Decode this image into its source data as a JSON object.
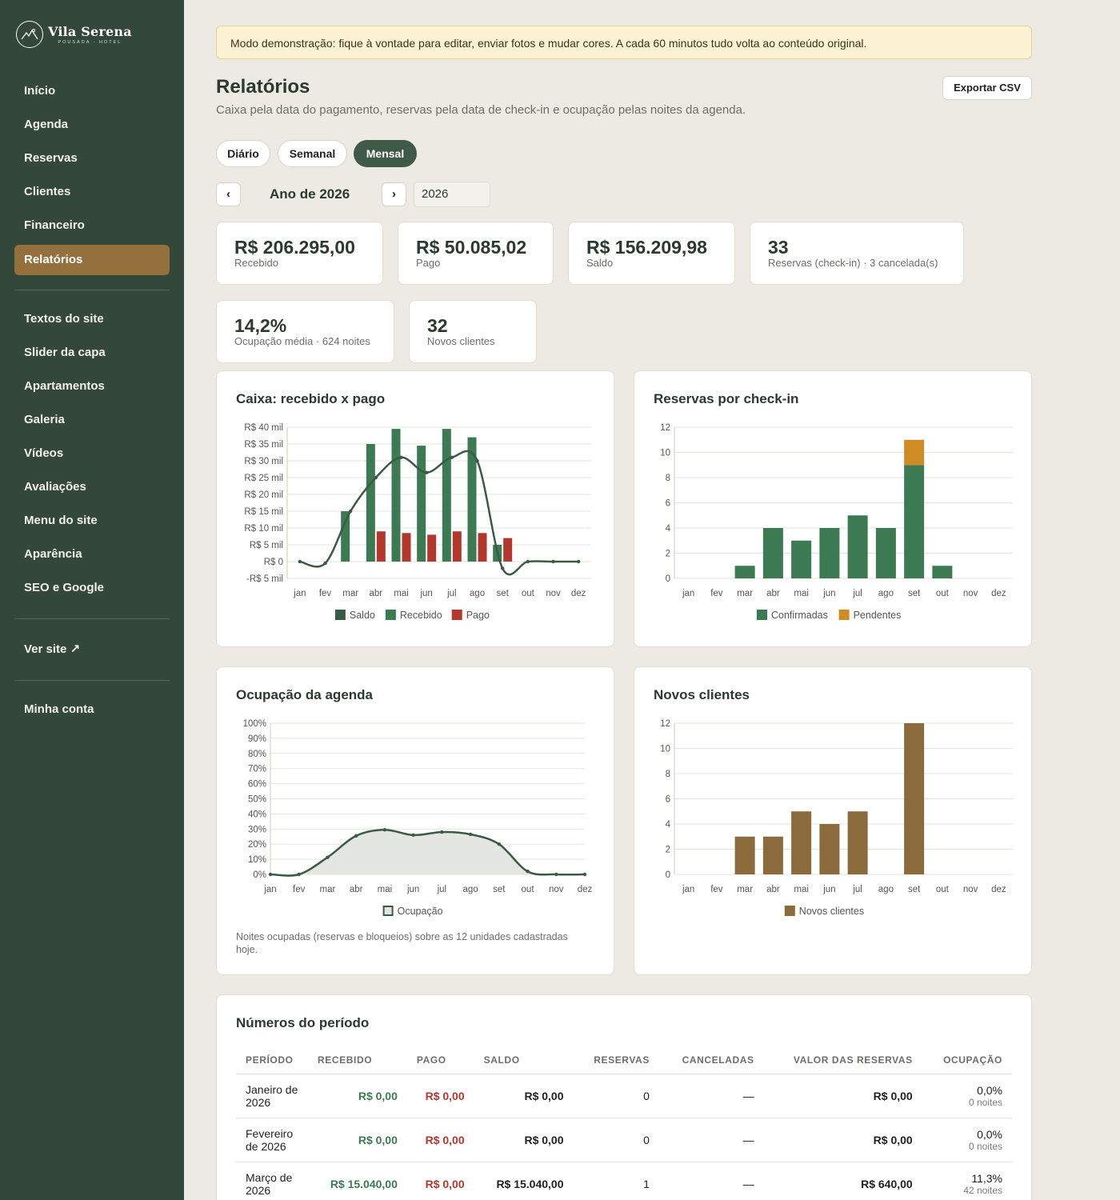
{
  "sidebar": {
    "brand_name": "Vila Serena",
    "brand_sub": "POUSADA · HOTEL",
    "items": [
      {
        "label": "Início"
      },
      {
        "label": "Agenda"
      },
      {
        "label": "Reservas"
      },
      {
        "label": "Clientes"
      },
      {
        "label": "Financeiro"
      },
      {
        "label": "Relatórios",
        "active": true
      },
      {
        "label": "Textos do site"
      },
      {
        "label": "Slider da capa"
      },
      {
        "label": "Apartamentos"
      },
      {
        "label": "Galeria"
      },
      {
        "label": "Vídeos"
      },
      {
        "label": "Avaliações"
      },
      {
        "label": "Menu do site"
      },
      {
        "label": "Aparência"
      },
      {
        "label": "SEO e Google"
      },
      {
        "label": "Ver site ↗"
      },
      {
        "label": "Minha conta"
      }
    ]
  },
  "banner": "Modo demonstração: fique à vontade para editar, enviar fotos e mudar cores. A cada 60 minutos tudo volta ao conteúdo original.",
  "header": {
    "title": "Relatórios",
    "subtitle": "Caixa pela data do pagamento, reservas pela data de check-in e ocupação pelas noites da agenda.",
    "export_label": "Exportar CSV"
  },
  "tabs": {
    "daily": "Diário",
    "weekly": "Semanal",
    "monthly": "Mensal",
    "active": "Mensal"
  },
  "period": {
    "prev": "‹",
    "next": "›",
    "label": "Ano de 2026",
    "year_value": "2026"
  },
  "kpis": [
    {
      "value": "R$ 206.295,00",
      "label": "Recebido"
    },
    {
      "value": "R$ 50.085,02",
      "label": "Pago"
    },
    {
      "value": "R$ 156.209,98",
      "label": "Saldo"
    },
    {
      "value": "33",
      "label": "Reservas (check-in) · 3 cancelada(s)"
    },
    {
      "value": "14,2%",
      "label": "Ocupação média · 624 noites"
    },
    {
      "value": "32",
      "label": "Novos clientes"
    }
  ],
  "colors": {
    "saldo": "#3a5a44",
    "recebido": "#3b7a52",
    "pago": "#b2382e",
    "pendentes": "#d08c24",
    "brown": "#8b6a3c",
    "occupancy_fill": "#e4e6e1"
  },
  "chart_data": [
    {
      "type": "bar",
      "title": "Caixa: recebido x pago",
      "categories": [
        "jan",
        "fev",
        "mar",
        "abr",
        "mai",
        "jun",
        "jul",
        "ago",
        "set",
        "out",
        "nov",
        "dez"
      ],
      "ytick_labels": [
        "R$ 40 mil",
        "R$ 35 mil",
        "R$ 30 mil",
        "R$ 25 mil",
        "R$ 20 mil",
        "R$ 15 mil",
        "R$ 10 mil",
        "R$ 5 mil",
        "R$ 0",
        "-R$ 5 mil"
      ],
      "ylim": [
        -5,
        40
      ],
      "yunit": "R$ mil",
      "series": [
        {
          "name": "Saldo",
          "kind": "line",
          "color": "#3a5a44",
          "values": [
            0,
            -0.5,
            15,
            25,
            31,
            26.5,
            31,
            30,
            -2,
            0,
            0,
            0
          ]
        },
        {
          "name": "Recebido",
          "kind": "bar",
          "color": "#3b7a52",
          "values": [
            0,
            0,
            15,
            35,
            39.5,
            34.5,
            39.5,
            37,
            5,
            0,
            0,
            0
          ]
        },
        {
          "name": "Pago",
          "kind": "bar",
          "color": "#b2382e",
          "values": [
            0,
            0,
            0,
            9,
            8.5,
            8,
            9,
            8.5,
            7,
            0,
            0,
            0
          ]
        }
      ],
      "legend": "bottom"
    },
    {
      "type": "bar",
      "stacked": true,
      "title": "Reservas por check-in",
      "categories": [
        "jan",
        "fev",
        "mar",
        "abr",
        "mai",
        "jun",
        "jul",
        "ago",
        "set",
        "out",
        "nov",
        "dez"
      ],
      "ytick_labels": [
        "12",
        "10",
        "8",
        "6",
        "4",
        "2",
        "0"
      ],
      "ylim": [
        0,
        12
      ],
      "series": [
        {
          "name": "Confirmadas",
          "color": "#3b7a52",
          "values": [
            0,
            0,
            1,
            4,
            3,
            4,
            5,
            4,
            9,
            1,
            0,
            0
          ]
        },
        {
          "name": "Pendentes",
          "color": "#d08c24",
          "values": [
            0,
            0,
            0,
            0,
            0,
            0,
            0,
            0,
            2,
            0,
            0,
            0
          ]
        }
      ],
      "legend": "bottom"
    },
    {
      "type": "area",
      "title": "Ocupação da agenda",
      "categories": [
        "jan",
        "fev",
        "mar",
        "abr",
        "mai",
        "jun",
        "jul",
        "ago",
        "set",
        "out",
        "nov",
        "dez"
      ],
      "ytick_labels": [
        "100%",
        "90%",
        "80%",
        "70%",
        "60%",
        "50%",
        "40%",
        "30%",
        "20%",
        "10%",
        "0%"
      ],
      "ylim": [
        0,
        100
      ],
      "series": [
        {
          "name": "Ocupação",
          "color": "#3a5a44",
          "values": [
            0,
            0,
            11.3,
            25.5,
            29.5,
            26,
            28,
            26.5,
            20,
            2,
            0,
            0
          ]
        }
      ],
      "note": "Noites ocupadas (reservas e bloqueios) sobre as 12 unidades cadastradas hoje.",
      "legend": "bottom"
    },
    {
      "type": "bar",
      "title": "Novos clientes",
      "categories": [
        "jan",
        "fev",
        "mar",
        "abr",
        "mai",
        "jun",
        "jul",
        "ago",
        "set",
        "out",
        "nov",
        "dez"
      ],
      "ytick_labels": [
        "12",
        "10",
        "8",
        "6",
        "4",
        "2",
        "0"
      ],
      "ylim": [
        0,
        12
      ],
      "series": [
        {
          "name": "Novos clientes",
          "color": "#8b6a3c",
          "values": [
            0,
            0,
            3,
            3,
            5,
            4,
            5,
            0,
            12,
            0,
            0,
            0
          ]
        }
      ],
      "legend": "bottom"
    }
  ],
  "table": {
    "title": "Números do período",
    "headers": [
      "PERÍODO",
      "RECEBIDO",
      "PAGO",
      "SALDO",
      "RESERVAS",
      "CANCELADAS",
      "VALOR DAS RESERVAS",
      "OCUPAÇÃO"
    ],
    "rows": [
      {
        "periodo": "Janeiro de 2026",
        "recebido": "R$ 0,00",
        "pago": "R$ 0,00",
        "saldo": "R$ 0,00",
        "reservas": "0",
        "canceladas": "—",
        "valor": "R$ 0,00",
        "ocupacao": "0,0%",
        "noites": "0 noites"
      },
      {
        "periodo": "Fevereiro de 2026",
        "recebido": "R$ 0,00",
        "pago": "R$ 0,00",
        "saldo": "R$ 0,00",
        "reservas": "0",
        "canceladas": "—",
        "valor": "R$ 0,00",
        "ocupacao": "0,0%",
        "noites": "0 noites"
      },
      {
        "periodo": "Março de 2026",
        "recebido": "R$ 15.040,00",
        "pago": "R$ 0,00",
        "saldo": "R$ 15.040,00",
        "reservas": "1",
        "canceladas": "—",
        "valor": "R$ 640,00",
        "ocupacao": "11,3%",
        "noites": "42 noites"
      }
    ]
  }
}
